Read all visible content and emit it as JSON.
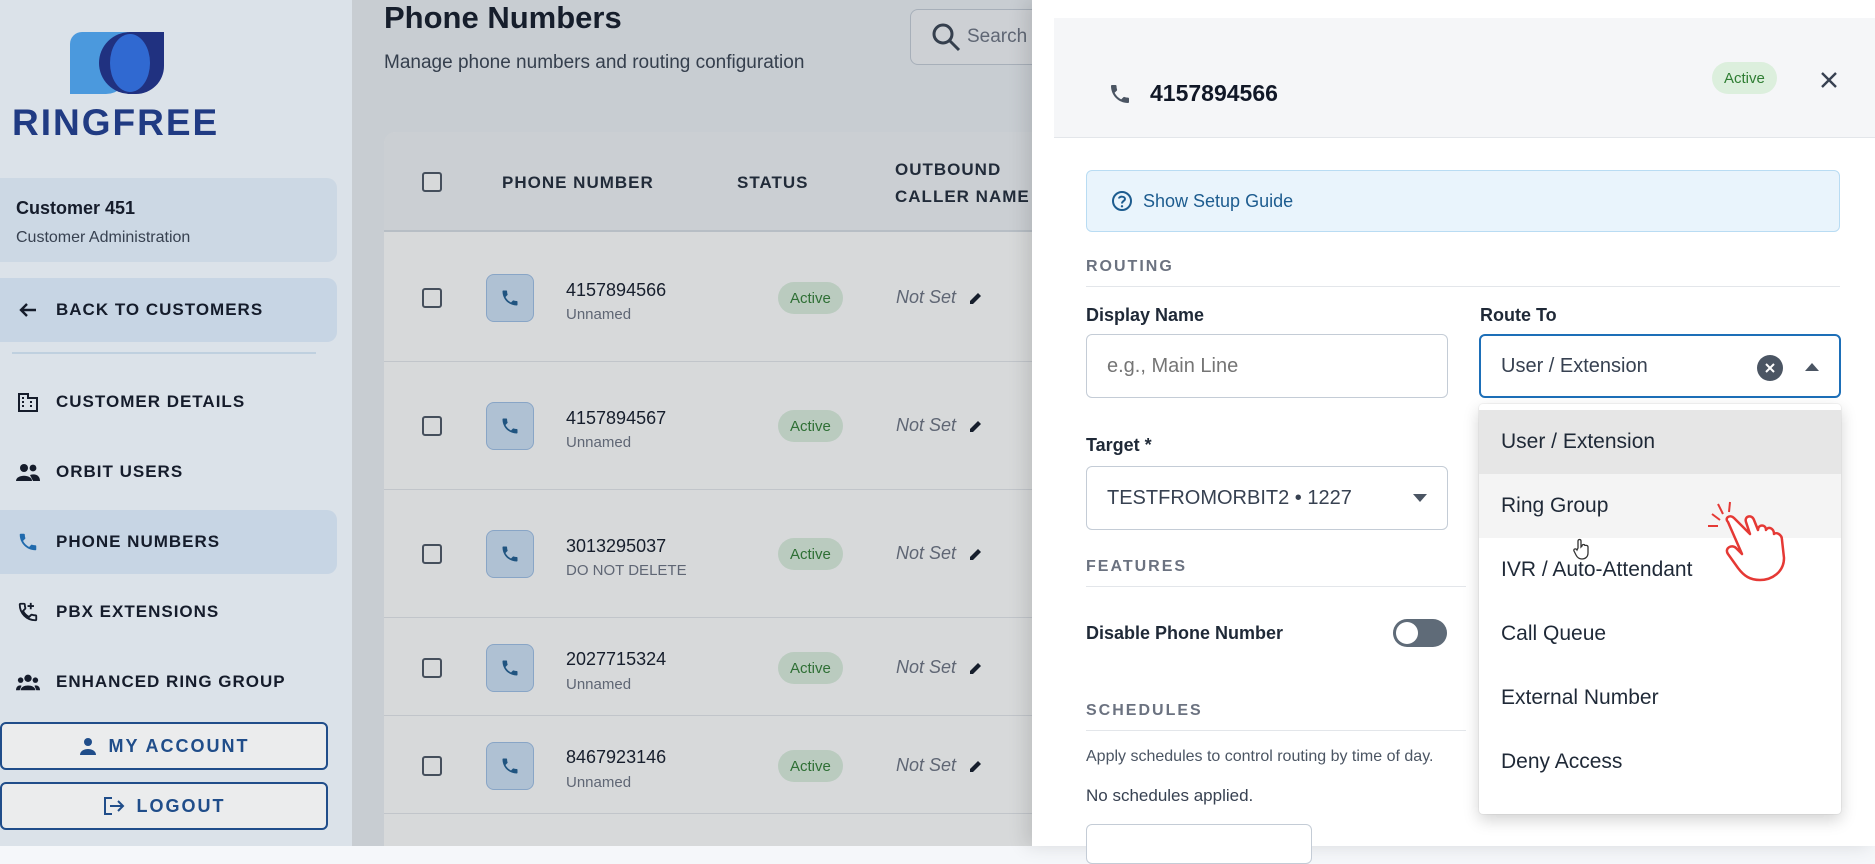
{
  "brand": {
    "name": "RINGFREE"
  },
  "sidebar": {
    "customer_name": "Customer 451",
    "customer_sub": "Customer Administration",
    "back_label": "BACK TO CUSTOMERS",
    "items": [
      {
        "label": "CUSTOMER DETAILS",
        "icon": "building-icon"
      },
      {
        "label": "ORBIT USERS",
        "icon": "users-icon"
      },
      {
        "label": "PHONE NUMBERS",
        "icon": "phone-icon",
        "active": true
      },
      {
        "label": "PBX EXTENSIONS",
        "icon": "phone-forward-icon"
      },
      {
        "label": "ENHANCED RING GROUP",
        "icon": "group-icon"
      }
    ],
    "my_account_label": "MY ACCOUNT",
    "logout_label": "LOGOUT"
  },
  "main": {
    "title": "Phone Numbers",
    "subtitle": "Manage phone numbers and routing configuration",
    "search_placeholder": "Search",
    "columns": [
      "PHONE NUMBER",
      "STATUS",
      "OUTBOUND",
      "CALLER NAME"
    ],
    "rows": [
      {
        "number": "4157894566",
        "name": "Unnamed",
        "status": "Active",
        "caller": "Not Set"
      },
      {
        "number": "4157894567",
        "name": "Unnamed",
        "status": "Active",
        "caller": "Not Set"
      },
      {
        "number": "3013295037",
        "name": "DO NOT DELETE",
        "status": "Active",
        "caller": "Not Set"
      },
      {
        "number": "2027715324",
        "name": "Unnamed",
        "status": "Active",
        "caller": "Not Set"
      },
      {
        "number": "8467923146",
        "name": "Unnamed",
        "status": "Active",
        "caller": "Not Set"
      }
    ]
  },
  "drawer": {
    "number": "4157894566",
    "status": "Active",
    "guide_label": "Show Setup Guide",
    "routing_title": "ROUTING",
    "display_name_label": "Display Name",
    "display_name_placeholder": "e.g., Main Line",
    "route_to_label": "Route To",
    "route_to_value": "User / Extension",
    "target_label": "Target *",
    "target_value": "TESTFROMORBIT2 • 1227",
    "features_title": "FEATURES",
    "disable_label": "Disable Phone Number",
    "disable_on": false,
    "schedules_title": "SCHEDULES",
    "schedules_desc": "Apply schedules to control routing by time of day.",
    "schedules_empty": "No schedules applied."
  },
  "route_menu": {
    "options": [
      "User / Extension",
      "Ring Group",
      "IVR / Auto-Attendant",
      "Call Queue",
      "External Number",
      "Deny Access"
    ],
    "selected_index": 0,
    "hover_index": 1
  },
  "colors": {
    "brand_navy": "#1e3a8a",
    "brand_blue": "#3b82f6",
    "accent": "#1d6fb8",
    "status_green": "#2e7d32",
    "status_bg": "#dcefdd"
  }
}
